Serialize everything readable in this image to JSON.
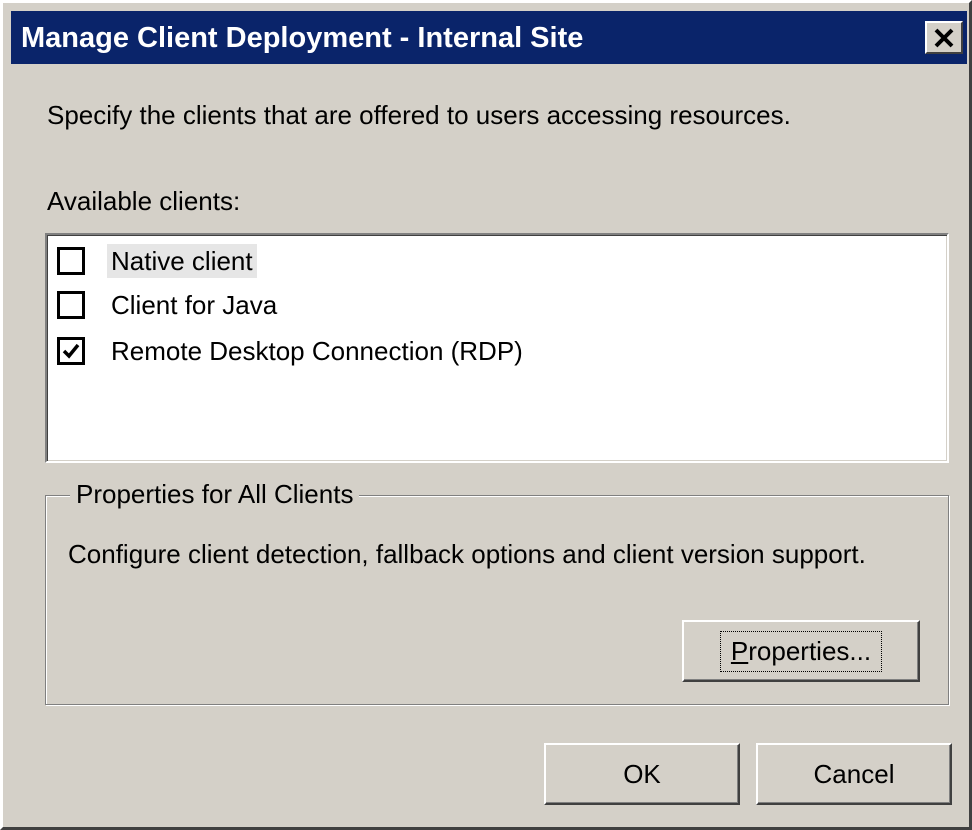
{
  "window": {
    "title": "Manage Client Deployment - Internal Site",
    "close_label": "×"
  },
  "intro_text": "Specify the clients that are offered to users accessing resources.",
  "available_clients": {
    "label": "Available clients:",
    "items": [
      {
        "label": "Native client",
        "checked": false,
        "focused": true
      },
      {
        "label": "Client for Java",
        "checked": false,
        "focused": false
      },
      {
        "label": "Remote Desktop Connection (RDP)",
        "checked": true,
        "focused": false
      }
    ]
  },
  "properties_group": {
    "legend": "Properties for All Clients",
    "description": "Configure client detection, fallback options and client version support.",
    "button_mnemonic": "P",
    "button_rest": "roperties..."
  },
  "buttons": {
    "ok": "OK",
    "cancel": "Cancel"
  }
}
